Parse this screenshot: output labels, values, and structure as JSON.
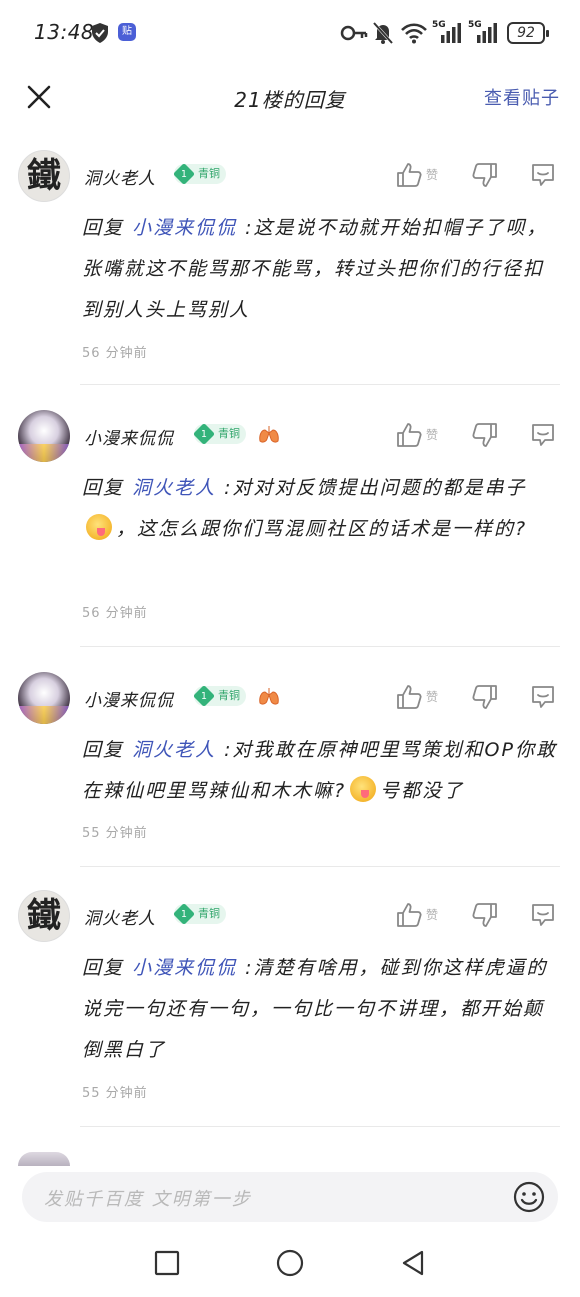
{
  "status": {
    "time": "13:48",
    "app_badge": "贴",
    "net1": "5G",
    "net2": "5G",
    "battery": "92"
  },
  "header": {
    "title": "21楼的回复",
    "link": "查看贴子"
  },
  "actions": {
    "like_label": "赞"
  },
  "replies": [
    {
      "user": "洞火老人",
      "level": "1",
      "badge": "青铜",
      "prefix": "回复",
      "mention": "小漫来侃侃",
      "text": ":这是说不动就开始扣帽子了呗， 张嘴就这不能骂那不能骂，转过头把你们的行径扣到别人头上骂别人",
      "time": "56 分钟前"
    },
    {
      "user": "小漫来侃侃",
      "level": "1",
      "badge": "青铜",
      "prefix": "回复",
      "mention": "洞火老人",
      "text_a": ":对对对反馈提出问题的都是串子",
      "text_b": "，这怎么跟你们骂混厕社区的话术是一样的?",
      "time": "56 分钟前"
    },
    {
      "user": "小漫来侃侃",
      "level": "1",
      "badge": "青铜",
      "prefix": "回复",
      "mention": "洞火老人",
      "text_a": ":对我敢在原神吧里骂策划和OP你敢在辣仙吧里骂辣仙和木木嘛?",
      "text_b": "号都没了",
      "time": "55 分钟前"
    },
    {
      "user": "洞火老人",
      "level": "1",
      "badge": "青铜",
      "prefix": "回复",
      "mention": "小漫来侃侃",
      "text": ":清楚有啥用，碰到你这样虎逼的说完一句还有一句，一句比一句不讲理，都开始颠倒黑白了",
      "time": "55 分钟前"
    }
  ],
  "input": {
    "placeholder": "发贴千百度 文明第一步"
  }
}
